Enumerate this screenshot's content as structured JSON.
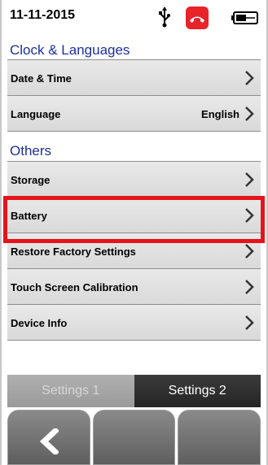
{
  "status": {
    "date": "11-11-2015",
    "icons": [
      "usb-icon",
      "hang-up-call-icon",
      "battery-icon"
    ]
  },
  "sections": [
    {
      "title": "Clock & Languages",
      "items": [
        {
          "label": "Date & Time",
          "value": ""
        },
        {
          "label": "Language",
          "value": "English"
        }
      ]
    },
    {
      "title": "Others",
      "items": [
        {
          "label": "Storage",
          "value": ""
        },
        {
          "label": "Battery",
          "value": ""
        },
        {
          "label": "Restore Factory Settings",
          "value": ""
        },
        {
          "label": "Touch Screen Calibration",
          "value": ""
        },
        {
          "label": "Device Info",
          "value": ""
        }
      ]
    }
  ],
  "tabs": [
    {
      "label": "Settings 1",
      "active": false
    },
    {
      "label": "Settings 2",
      "active": true
    }
  ],
  "bottom_buttons": [
    "back-icon",
    "",
    ""
  ],
  "highlight_item": "Battery",
  "colors": {
    "section_title": "#1c2f9a",
    "highlight": "#e5141b",
    "call_icon": "#e8232a"
  }
}
